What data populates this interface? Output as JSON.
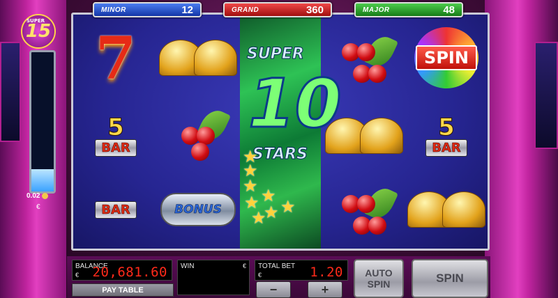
{
  "jackpots": {
    "minor": {
      "label": "MINOR",
      "value": "12"
    },
    "grand": {
      "label": "GRAND",
      "value": "360"
    },
    "major": {
      "label": "MAJOR",
      "value": "48"
    }
  },
  "meter": {
    "badge_small": "SUPER",
    "badge_num": "15",
    "value": "0.02",
    "currency": "€",
    "fill_fraction": 0.16
  },
  "feature_reel": {
    "top_text": "SUPER",
    "number": "10",
    "bottom_text": "STARS"
  },
  "symbols": {
    "bar5_num": "5",
    "bar_text": "BAR",
    "bonus_text": "BONUS",
    "spin_text": "SPIN"
  },
  "panel": {
    "balance_label": "BALANCE",
    "balance_currency": "€",
    "balance_value": "20,681.60",
    "win_label": "WIN",
    "win_currency": "€",
    "win_value": "",
    "total_bet_label": "TOTAL BET",
    "total_bet_currency": "€",
    "total_bet_value": "1.20",
    "pay_table": "PAY TABLE",
    "minus": "−",
    "plus": "+",
    "auto_spin": "AUTO SPIN",
    "spin": "SPIN"
  },
  "colors": {
    "minor": "#1f4fd0",
    "grand": "#c41616",
    "major": "#1f9a1f",
    "led": "#ff2a1a"
  }
}
